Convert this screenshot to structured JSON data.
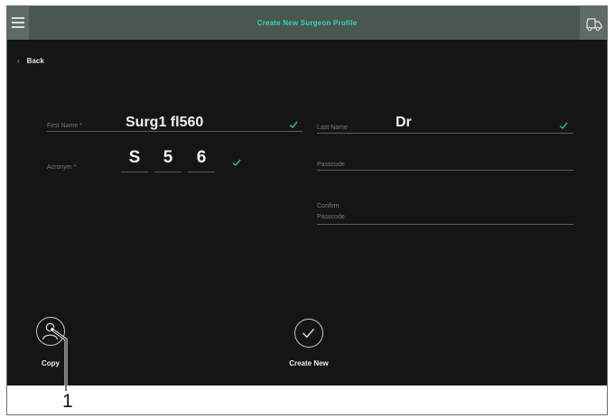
{
  "header": {
    "title": "Create New Surgeon Profile"
  },
  "nav": {
    "back_label": "Back"
  },
  "form": {
    "first_name": {
      "label": "First Name *",
      "value": "Surg1 fl560"
    },
    "last_name": {
      "label": "Last Name",
      "value": "Dr"
    },
    "acronym": {
      "label": "Acronym *",
      "letters": [
        "S",
        "5",
        "6"
      ]
    },
    "passcode": {
      "label": "Passcode",
      "value": ""
    },
    "confirm_passcode": {
      "label_line1": "Confirm",
      "label_line2": "Passcode",
      "value": ""
    }
  },
  "actions": {
    "copy_label": "Copy",
    "create_label": "Create New"
  },
  "callout": {
    "number": "1"
  },
  "colors": {
    "accent": "#37d3bb",
    "check": "#2eb89f",
    "background": "#151515",
    "header": "#4a5650"
  },
  "icons": [
    "menu-icon",
    "truck-icon",
    "chevron-left-icon",
    "check-icon",
    "person-icon",
    "checkmark-circle-icon"
  ]
}
